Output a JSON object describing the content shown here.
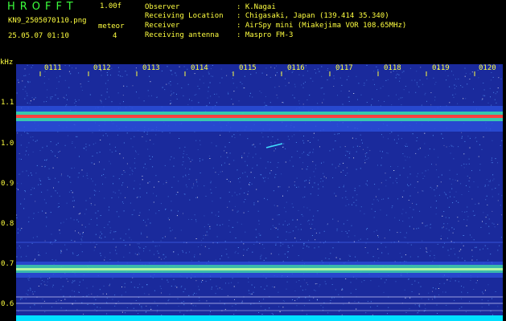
{
  "header": {
    "app_title": "HROFFT",
    "version": "1.00f",
    "filename": "KN9_2505070110.png",
    "mode": "meteor",
    "datetime": "25.05.07 01:10",
    "count": "4",
    "info": [
      {
        "label": "Observer",
        "value": ": K.Nagai"
      },
      {
        "label": "Receiving Location",
        "value": ": Chigasaki, Japan (139.414 35.340)"
      },
      {
        "label": "Receiver",
        "value": ": AirSpy mini (Miakejima VOR 108.65MHz)"
      },
      {
        "label": "Receiving antenna",
        "value": ": Maspro FM-3"
      }
    ]
  },
  "waterfall": {
    "unit_label": "kHz",
    "y_ticks": [
      "1.1",
      "1.0",
      "0.9",
      "0.8",
      "0.7",
      "0.6"
    ],
    "x_ticks": [
      "0111",
      "0112",
      "0113",
      "0114",
      "0115",
      "0116",
      "0117",
      "0118",
      "0119",
      "0120"
    ],
    "colors": {
      "background": "#1a2a9c",
      "noise": "#5aa0ff",
      "carrier_core": "#ff4040",
      "carrier_glow": "#40ffa0",
      "text": "#ffff40",
      "title": "#3cff3c",
      "baseline": "#00e0ff"
    }
  }
}
